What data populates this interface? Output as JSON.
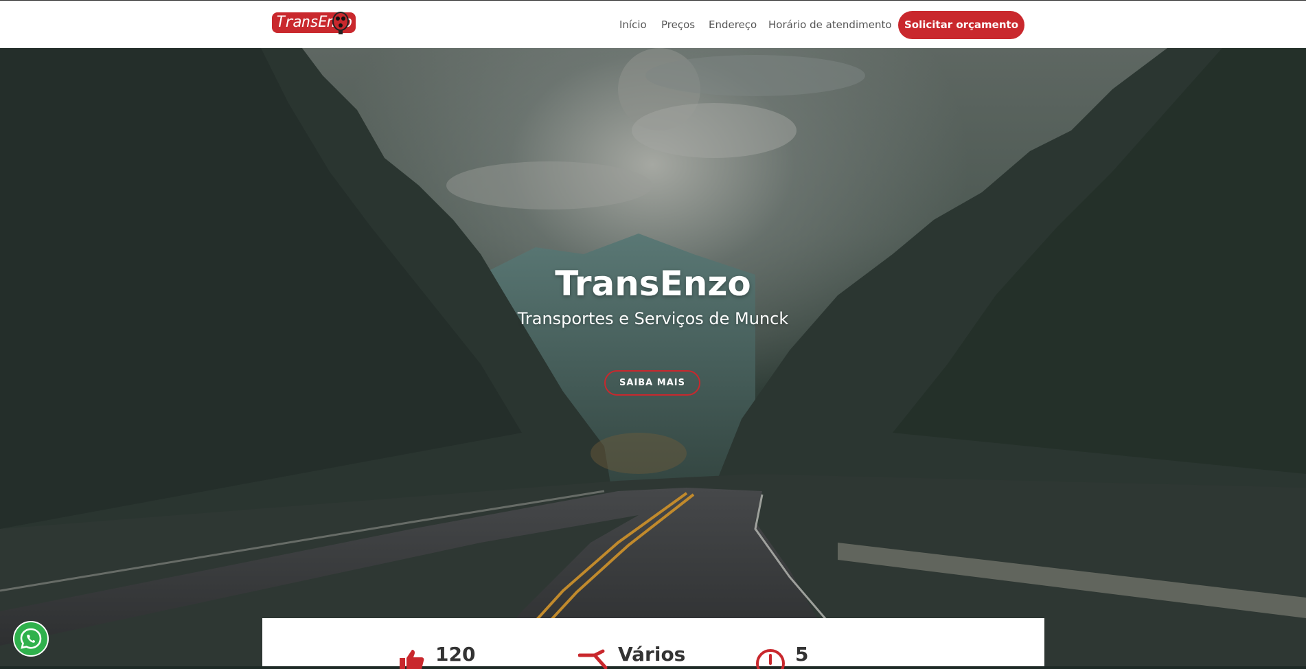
{
  "header": {
    "logo_text": "TransEnzo",
    "nav": [
      {
        "label": "Início"
      },
      {
        "label": "Preços"
      },
      {
        "label": "Endereço"
      },
      {
        "label": "Horário de atendimento"
      }
    ],
    "cta_label": "Solicitar orçamento"
  },
  "hero": {
    "title": "TransEnzo",
    "subtitle": "Transportes e Serviços de Munck",
    "button_label": "SAIBA MAIS"
  },
  "stats": [
    {
      "icon": "thumbs-up-icon",
      "value": "120"
    },
    {
      "icon": "truck-icon",
      "value": "Vários"
    },
    {
      "icon": "clock-icon",
      "value": "5"
    }
  ],
  "floating": {
    "icon": "whatsapp-icon"
  },
  "colors": {
    "accent": "#c9282d",
    "whatsapp": "#2fb14c",
    "header_bg": "#ffffff",
    "nav_text": "#555555"
  }
}
